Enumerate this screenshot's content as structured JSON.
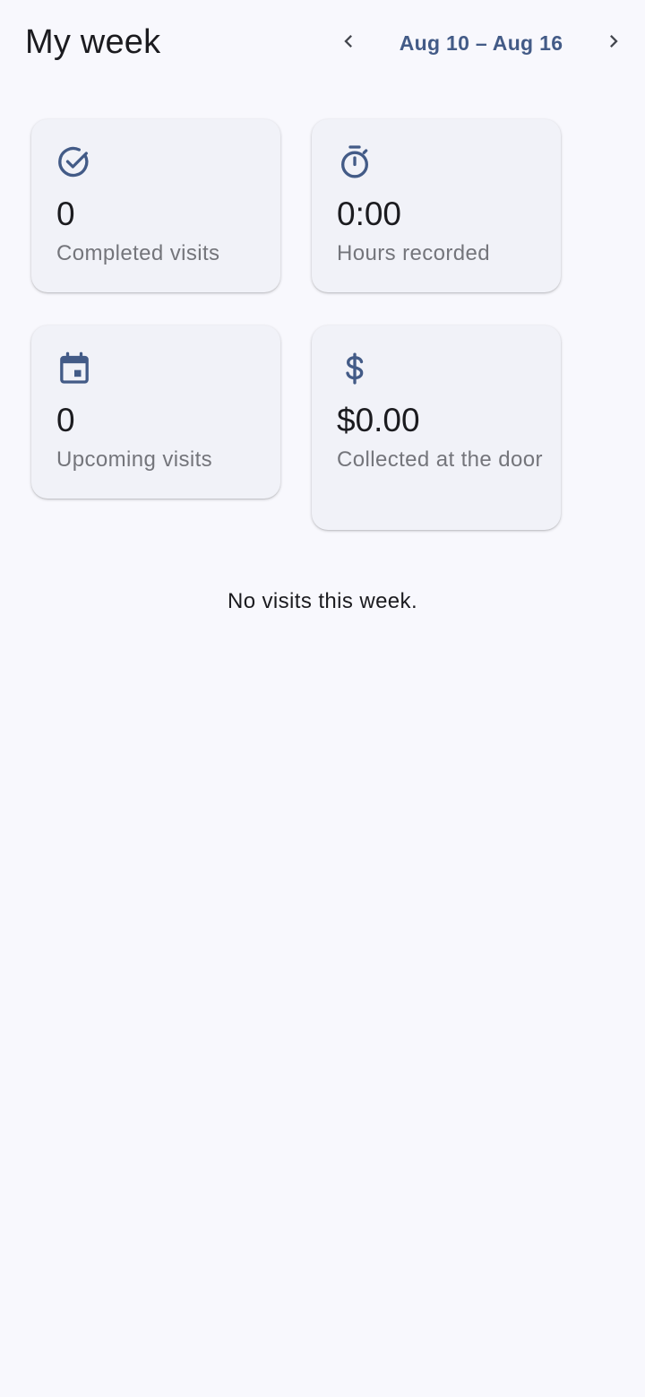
{
  "header": {
    "title": "My week",
    "date_range": "Aug 10 – Aug 16",
    "prev_icon": "chevron-left-icon",
    "next_icon": "chevron-right-icon"
  },
  "stats": [
    {
      "icon": "check-circle-icon",
      "value": "0",
      "label": "Completed visits"
    },
    {
      "icon": "stopwatch-icon",
      "value": "0:00",
      "label": "Hours recorded"
    },
    {
      "icon": "calendar-icon",
      "value": "0",
      "label": "Upcoming visits"
    },
    {
      "icon": "dollar-icon",
      "value": "$0.00",
      "label": "Collected at the door"
    }
  ],
  "empty_state": {
    "message": "No visits this week."
  },
  "colors": {
    "background": "#f8f8fd",
    "card": "#f1f2f8",
    "accent": "#435b87",
    "text": "#1b1b1f",
    "muted": "#74757b"
  }
}
